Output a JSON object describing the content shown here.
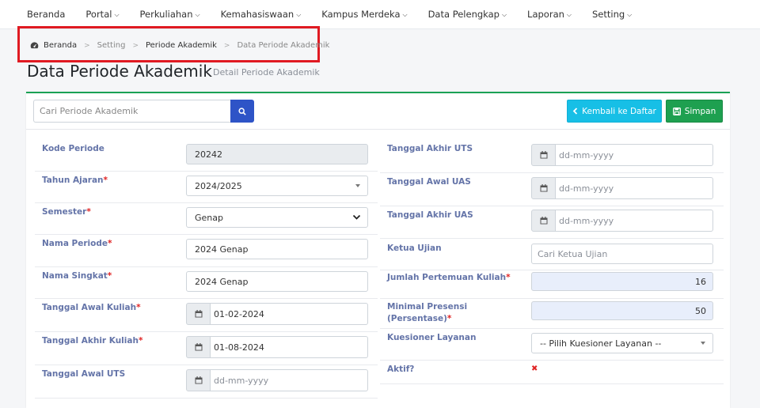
{
  "nav": {
    "items": [
      {
        "label": "Beranda",
        "caret": ""
      },
      {
        "label": "Portal",
        "caret": "⌵"
      },
      {
        "label": "Perkuliahan",
        "caret": "⌵"
      },
      {
        "label": "Kemahasiswaan",
        "caret": "⌵"
      },
      {
        "label": "Kampus Merdeka",
        "caret": "⌵"
      },
      {
        "label": "Data Pelengkap",
        "caret": "⌵"
      },
      {
        "label": "Laporan",
        "caret": "⌵"
      },
      {
        "label": "Setting",
        "caret": "⌵"
      }
    ]
  },
  "breadcrumb": {
    "home_icon": "dashboard-icon",
    "items": [
      "Beranda",
      "Setting",
      "Periode Akademik",
      "Data Periode Akademik"
    ],
    "sep": ">"
  },
  "page": {
    "title": "Data Periode Akademik",
    "subtitle": "Detail Periode Akademik"
  },
  "toolbar": {
    "search_placeholder": "Cari Periode Akademik",
    "back_label": "Kembali ke Daftar",
    "save_label": "Simpan"
  },
  "form_left": {
    "kode_periode": {
      "label": "Kode Periode",
      "value": "20242"
    },
    "tahun_ajaran": {
      "label": "Tahun Ajaran",
      "value": "2024/2025"
    },
    "semester": {
      "label": "Semester",
      "value": "Genap"
    },
    "nama_periode": {
      "label": "Nama Periode",
      "value": "2024 Genap"
    },
    "nama_singkat": {
      "label": "Nama Singkat",
      "value": "2024 Genap"
    },
    "tgl_awal_kuliah": {
      "label": "Tanggal Awal Kuliah",
      "value": "01-02-2024"
    },
    "tgl_akhir_kuliah": {
      "label": "Tanggal Akhir Kuliah",
      "value": "01-08-2024"
    },
    "tgl_awal_uts": {
      "label": "Tanggal Awal UTS",
      "placeholder": "dd-mm-yyyy"
    }
  },
  "form_right": {
    "tgl_akhir_uts": {
      "label": "Tanggal Akhir UTS",
      "placeholder": "dd-mm-yyyy"
    },
    "tgl_awal_uas": {
      "label": "Tanggal Awal UAS",
      "placeholder": "dd-mm-yyyy"
    },
    "tgl_akhir_uas": {
      "label": "Tanggal Akhir UAS",
      "placeholder": "dd-mm-yyyy"
    },
    "ketua_ujian": {
      "label": "Ketua Ujian",
      "placeholder": "Cari Ketua Ujian"
    },
    "jumlah_pertemuan": {
      "label": "Jumlah Pertemuan Kuliah",
      "value": "16"
    },
    "minimal_presensi": {
      "label1": "Minimal Presensi",
      "label2": "(Persentase)",
      "value": "50"
    },
    "kuesioner": {
      "label": "Kuesioner Layanan",
      "value": "-- Pilih Kuesioner Layanan --"
    },
    "aktif": {
      "label": "Aktif?",
      "value": "✖"
    }
  },
  "required_mark": "*",
  "colors": {
    "accent_green": "#1ea050",
    "accent_cyan": "#17bfe6",
    "search_blue": "#2e54c7",
    "label": "#6474a8",
    "required": "#e02424"
  }
}
